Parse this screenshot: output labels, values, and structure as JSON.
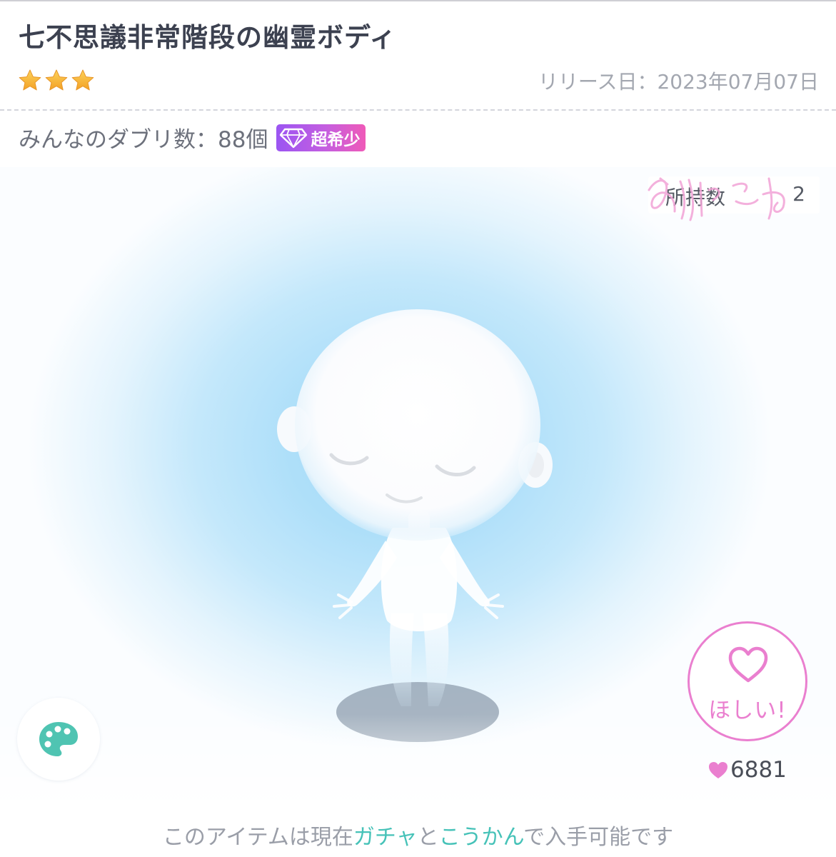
{
  "item": {
    "title": "七不思議非常階段の幽霊ボディ",
    "rarity_stars": 3,
    "release_label": "リリース日：2023年07月07日"
  },
  "duplicates": {
    "label": "みんなのダブリ数：88個",
    "badge_icon": "diamond-icon",
    "badge_label": "超希少"
  },
  "preview": {
    "owned_label": "所持数",
    "owned_value": "2",
    "palette_icon": "palette-icon",
    "want_button_label": "ほしい!",
    "want_icon": "heart-outline-icon",
    "like_count": "6881"
  },
  "footer": {
    "prefix": "このアイテムは現在",
    "link_gacha": "ガチャ",
    "middle": "と",
    "link_exchange": "こうかん",
    "suffix": "で入手可能です"
  },
  "colors": {
    "accent_pink": "#ea7fcf",
    "link_teal": "#46c2b8",
    "star_gold": "#f7b531",
    "badge_purple": "#9b55f2",
    "palette_teal": "#4fc4b2"
  }
}
